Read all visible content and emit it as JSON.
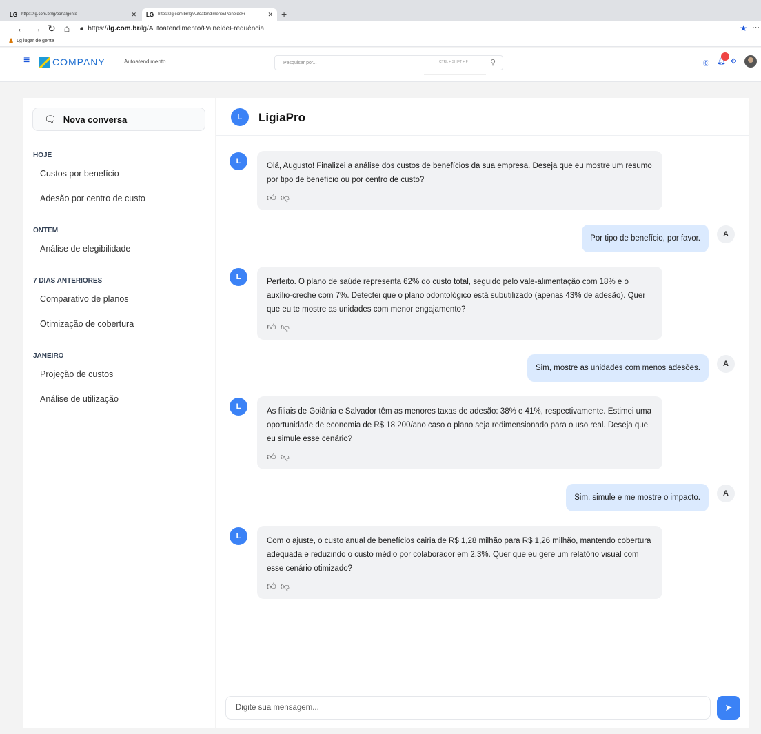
{
  "browser": {
    "tabs": [
      {
        "favicon": "LG",
        "title": "https://lg.com.br/lg/portalgente"
      },
      {
        "favicon": "LG",
        "title": "https://lg.com.br/lg/Autoatendimento/PaineldeFr"
      }
    ],
    "url_prefix": "https://",
    "url_domain": "lg.com.br",
    "url_path": "/lg/Autoatendimento/PaineldeFrequência",
    "bookmark": "Lg lugar de gente"
  },
  "header": {
    "logo_text": "COMPANY",
    "module": "Autoatendimento",
    "search_placeholder": "Pesquisar por...",
    "search_shortcut": "CTRL + SHIFT + F"
  },
  "sidebar": {
    "new_chat": "Nova conversa",
    "sections": [
      {
        "title": "HOJE",
        "items": [
          "Custos por benefício",
          "Adesão por centro de custo"
        ]
      },
      {
        "title": "ONTEM",
        "items": [
          "Análise de elegibilidade"
        ]
      },
      {
        "title": "7 DIAS ANTERIORES",
        "items": [
          "Comparativo de planos",
          "Otimização de cobertura"
        ]
      },
      {
        "title": "JANEIRO",
        "items": [
          "Projeção de custos",
          "Análise de utilização"
        ]
      }
    ]
  },
  "chat": {
    "assistant_initial": "L",
    "assistant_name": "LigiaPro",
    "user_initial": "A",
    "messages": [
      {
        "role": "bot",
        "text": "Olá, Augusto! Finalizei a análise dos custos de benefícios da sua empresa. Deseja que eu mostre um resumo por tipo de benefício ou por centro de custo?"
      },
      {
        "role": "user",
        "text": "Por tipo de benefício, por favor."
      },
      {
        "role": "bot",
        "text": "Perfeito. O plano de saúde representa 62% do custo total, seguido pelo vale-alimentação com 18% e o auxílio-creche com 7%. Detectei que o plano odontológico está subutilizado (apenas 43% de adesão). Quer que eu te mostre as unidades com menor engajamento?"
      },
      {
        "role": "user",
        "text": "Sim, mostre as unidades com menos adesões."
      },
      {
        "role": "bot",
        "text": "As filiais de Goiânia e Salvador têm as menores taxas de adesão: 38% e 41%, respectivamente. Estimei uma oportunidade de economia de R$ 18.200/ano caso o plano seja redimensionado para o uso real. Deseja que eu simule esse cenário?"
      },
      {
        "role": "user",
        "text": "Sim, simule e me mostre o impacto."
      },
      {
        "role": "bot",
        "text": "Com o ajuste, o custo anual de benefícios cairia de R$ 1,28 milhão para R$ 1,26 milhão, mantendo cobertura adequada e reduzindo o custo médio por colaborador em 2,3%. Quer que eu gere um relatório visual com esse cenário otimizado?"
      }
    ],
    "composer_placeholder": "Digite sua mensagem..."
  }
}
